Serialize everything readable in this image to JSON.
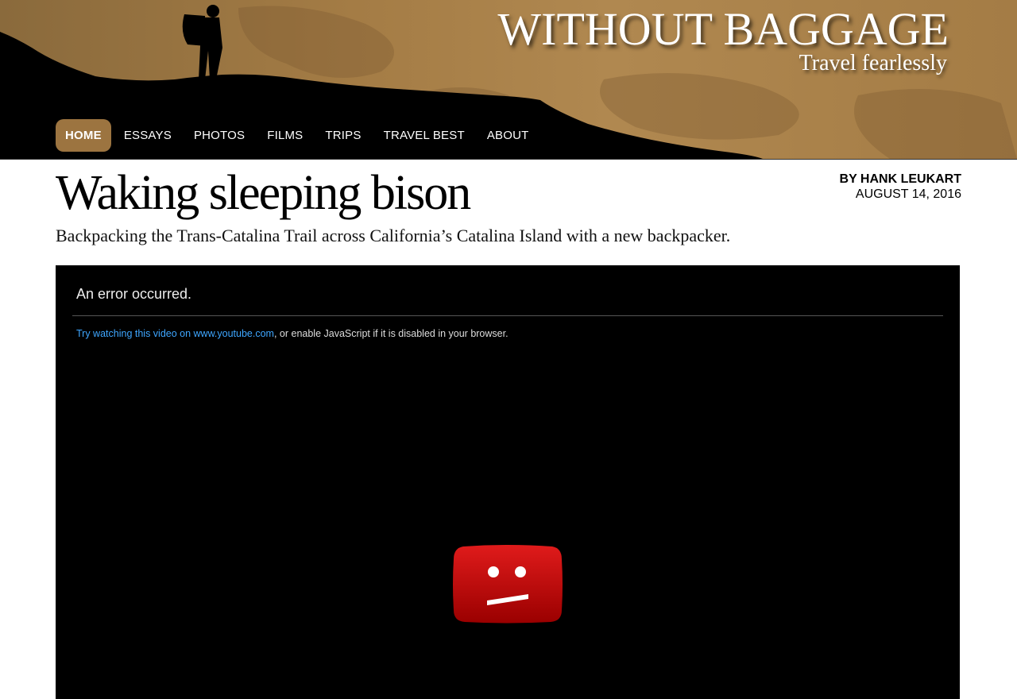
{
  "site": {
    "title": "WITHOUT BAGGAGE",
    "tagline": "Travel fearlessly"
  },
  "nav": {
    "items": [
      {
        "label": "HOME",
        "active": true
      },
      {
        "label": "ESSAYS",
        "active": false
      },
      {
        "label": "PHOTOS",
        "active": false
      },
      {
        "label": "FILMS",
        "active": false
      },
      {
        "label": "TRIPS",
        "active": false
      },
      {
        "label": "TRAVEL BEST",
        "active": false
      },
      {
        "label": "ABOUT",
        "active": false
      }
    ]
  },
  "article": {
    "title": "Waking sleeping bison",
    "subtitle": "Backpacking the Trans-Catalina Trail across California’s Catalina Island with a new backpacker.",
    "byline": "BY HANK LEUKART",
    "date": "AUGUST 14, 2016"
  },
  "video": {
    "error_title": "An error occurred.",
    "help_link": "Try watching this video on www.youtube.com",
    "help_rest": ", or enable JavaScript if it is disabled in your browser.",
    "icon": "sad-youtube-icon"
  },
  "colors": {
    "banner": "#a47c45",
    "nav_active": "#9c7440",
    "link": "#3ea6ff",
    "error_icon": "#cc0000"
  }
}
